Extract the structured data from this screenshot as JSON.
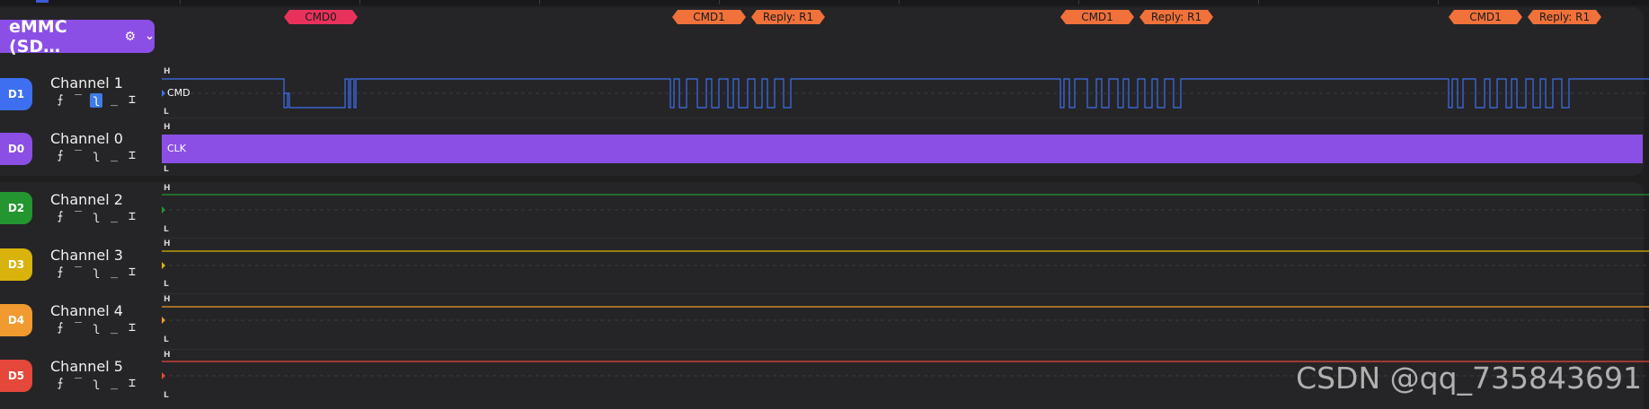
{
  "analyzer": {
    "label": "eMMC (SD…",
    "gear_icon": "gear-icon",
    "chevron_icon": "chevron-down-icon",
    "color": "#8b4fe6"
  },
  "annotations": [
    {
      "label": "CMD0",
      "color": "#e8325c"
    },
    {
      "label": "CMD1",
      "color": "#f0713a"
    },
    {
      "label": "Reply: R1",
      "color": "#f0713a"
    },
    {
      "label": "CMD1",
      "color": "#f0713a"
    },
    {
      "label": "Reply: R1",
      "color": "#f0713a"
    },
    {
      "label": "CMD1",
      "color": "#f0713a"
    },
    {
      "label": "Reply: R1",
      "color": "#f0713a"
    }
  ],
  "channels": [
    {
      "badge": "D1",
      "name": "Channel 1",
      "color": "#3d6ff0",
      "signal": "CMD",
      "high": "H",
      "low": "L"
    },
    {
      "badge": "D0",
      "name": "Channel 0",
      "color": "#8b4fe6",
      "signal": "CLK",
      "high": "H",
      "low": "L"
    },
    {
      "badge": "D2",
      "name": "Channel 2",
      "color": "#23962f",
      "signal": "",
      "high": "H",
      "low": "L"
    },
    {
      "badge": "D3",
      "name": "Channel 3",
      "color": "#d9b30c",
      "signal": "",
      "high": "H",
      "low": "L"
    },
    {
      "badge": "D4",
      "name": "Channel 4",
      "color": "#f09a2f",
      "signal": "",
      "high": "H",
      "low": "L"
    },
    {
      "badge": "D5",
      "name": "Channel 5",
      "color": "#e5483b",
      "signal": "",
      "high": "H",
      "low": "L"
    }
  ],
  "trigger_icons": [
    "rising-edge-icon",
    "high-level-icon",
    "falling-edge-icon",
    "low-level-icon",
    "any-edge-icon"
  ],
  "watermark": "CSDN @qq_735843691"
}
